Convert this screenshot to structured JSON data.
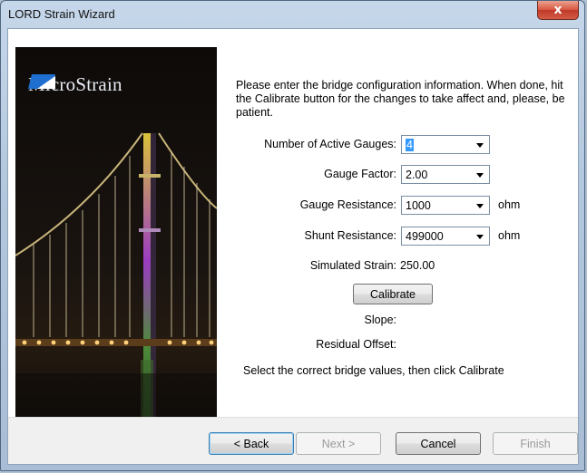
{
  "window": {
    "title": "LORD Strain Wizard",
    "close_glyph": "x"
  },
  "banner": {
    "logo_text": "MicroStrain",
    "logo_icon": "microstrain-logo-icon"
  },
  "intro_text": "Please enter the bridge configuration information.  When done, hit the Calibrate button for the changes to take affect and, please, be patient.",
  "form": {
    "active_gauges": {
      "label": "Number of Active Gauges:",
      "value": "4"
    },
    "gauge_factor": {
      "label": "Gauge Factor:",
      "value": "2.00"
    },
    "gauge_resistance": {
      "label": "Gauge Resistance:",
      "value": "1000",
      "unit": "ohm"
    },
    "shunt_resistance": {
      "label": "Shunt Resistance:",
      "value": "499000",
      "unit": "ohm"
    },
    "simulated_strain": {
      "label": "Simulated Strain:",
      "value": "250.00"
    },
    "calibrate_label": "Calibrate",
    "slope": {
      "label": "Slope:",
      "value": ""
    },
    "residual_offset": {
      "label": "Residual Offset:",
      "value": ""
    },
    "hint": "Select the correct bridge values, then click Calibrate"
  },
  "footer": {
    "back_label": "< Back",
    "next_label": "Next >",
    "cancel_label": "Cancel",
    "finish_label": "Finish"
  }
}
